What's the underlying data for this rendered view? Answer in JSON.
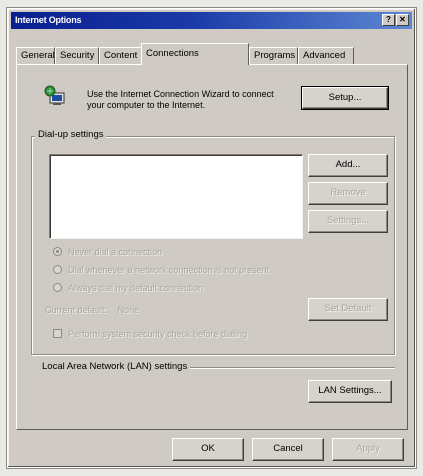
{
  "window": {
    "title": "Internet Options",
    "help_glyph": "?",
    "close_glyph": "✕"
  },
  "tabs": [
    {
      "label": "General"
    },
    {
      "label": "Security"
    },
    {
      "label": "Content"
    },
    {
      "label": "Connections"
    },
    {
      "label": "Programs"
    },
    {
      "label": "Advanced"
    }
  ],
  "active_tab": "Connections",
  "wizard": {
    "text": "Use the Internet Connection Wizard to connect your computer to the Internet.",
    "setup_button": "Setup..."
  },
  "dialup": {
    "group_label": "Dial-up settings",
    "list_items": [],
    "add_button": "Add...",
    "remove_button": "Remove",
    "settings_button": "Settings...",
    "radio_never": "Never dial a connection",
    "radio_no_network": "Dial whenever a network connection is not present",
    "radio_always": "Always dial my default connection",
    "current_default_label": "Current default:",
    "current_default_value": "None",
    "set_default_button": "Set Default",
    "checkbox_security": "Perform system security check before dialing"
  },
  "lan": {
    "label": "Local Area Network (LAN) settings",
    "lan_settings_button": "LAN Settings..."
  },
  "footer": {
    "ok": "OK",
    "cancel": "Cancel",
    "apply": "Apply"
  }
}
